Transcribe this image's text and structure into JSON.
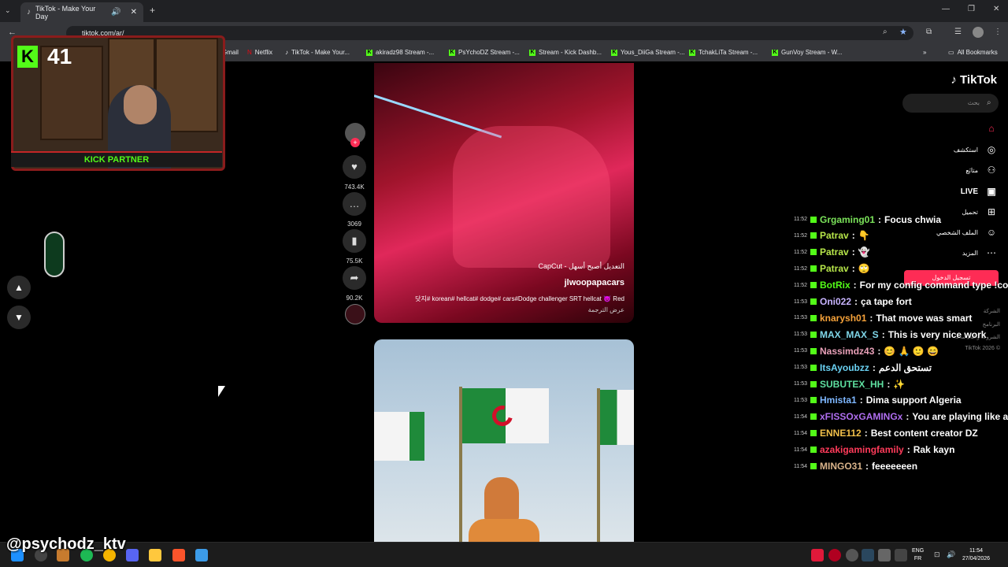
{
  "browser": {
    "tab_title": "TikTok - Make Your Day",
    "url": "tiktok.com/ar/",
    "bookmarks": [
      "Gmail",
      "Netflix",
      "TikTok - Make Your...",
      "akiradz98 Stream -...",
      "PsYchoDZ Stream -...",
      "Stream - Kick Dashb...",
      "Yous_DiiGa Stream -...",
      "TchakLiTa Stream -...",
      "GunVoy Stream - W..."
    ],
    "all_bookmarks": "All Bookmarks"
  },
  "overlay": {
    "kick_count": "41",
    "kick_partner": "KICK PARTNER",
    "handle": "@psychodz_ktv"
  },
  "feed": {
    "actions": [
      {
        "icon": "heart-icon",
        "glyph": "♥",
        "count": "743.4K"
      },
      {
        "icon": "comment-icon",
        "glyph": "…",
        "count": "3069"
      },
      {
        "icon": "bookmark-icon",
        "glyph": "▮",
        "count": "75.5K"
      },
      {
        "icon": "share-icon",
        "glyph": "➦",
        "count": "90.2K"
      }
    ],
    "video1": {
      "capcut": "CapCut - التعديل أصبح أسهل",
      "author": "jlwoopapacars",
      "caption": "닷지# korean# hellcat# dodge# cars#Dodge challenger SRT hellcat 👿 Red",
      "translate": "عرض الترجمة"
    }
  },
  "tiktok": {
    "logo": "TikTok",
    "search_placeholder": "بحث",
    "nav": [
      "استكشف",
      "متابَع",
      "LIVE",
      "تحميل",
      "الملف الشخصي",
      "المزيد"
    ],
    "login": "تسجيل الدخول",
    "footer": [
      "الشركة",
      "البرنامج",
      "الشروط والسياسات",
      "TikTok 2026 ©"
    ]
  },
  "chat": [
    {
      "time": "11:52",
      "user": "Grgaming01",
      "color": "#7be35a",
      "msg": "Focus chwia"
    },
    {
      "time": "11:52",
      "user": "Patrav",
      "color": "#b7e64a",
      "msg": "👇"
    },
    {
      "time": "11:52",
      "user": "Patrav",
      "color": "#b7e64a",
      "msg": "👻"
    },
    {
      "time": "11:52",
      "user": "Patrav",
      "color": "#b7e64a",
      "msg": "🙄"
    },
    {
      "time": "11:52",
      "user": "BotRix",
      "color": "#53fc18",
      "msg": "For my config command type !con"
    },
    {
      "time": "11:53",
      "user": "Oni022",
      "color": "#c8b4ff",
      "msg": "ça tape fort"
    },
    {
      "time": "11:53",
      "user": "knarysh01",
      "color": "#f6a23a",
      "msg": "That move was smart"
    },
    {
      "time": "11:53",
      "user": "MAX_MAX_S",
      "color": "#7fd6e8",
      "msg": "This is very nice work"
    },
    {
      "time": "11:53",
      "user": "Nassimdz43",
      "color": "#e8a0b8",
      "msg": "😊 🙏 🙂 😄"
    },
    {
      "time": "11:53",
      "user": "ItsAyoubzz",
      "color": "#6ad1f2",
      "msg": "تستحق الدعم"
    },
    {
      "time": "11:53",
      "user": "SUBUTEX_HH",
      "color": "#5ee0a0",
      "msg": "✨"
    },
    {
      "time": "11:53",
      "user": "Hmista1",
      "color": "#7eb7ff",
      "msg": "Dima support Algeria"
    },
    {
      "time": "11:54",
      "user": "xFISSOxGAMINGx",
      "color": "#b06ef0",
      "msg": "You are playing like a true"
    },
    {
      "time": "11:54",
      "user": "ENNE112",
      "color": "#f2c04a",
      "msg": "Best content creator DZ"
    },
    {
      "time": "11:54",
      "user": "azakigamingfamily",
      "color": "#ff3b5a",
      "msg": "Rak kayn"
    },
    {
      "time": "11:54",
      "user": "MINGO31",
      "color": "#d9b38a",
      "msg": "feeeeeeen"
    }
  ],
  "taskbar": {
    "lang": "ENG",
    "region": "FR",
    "time": "11:54",
    "date": "27/04/2026"
  }
}
